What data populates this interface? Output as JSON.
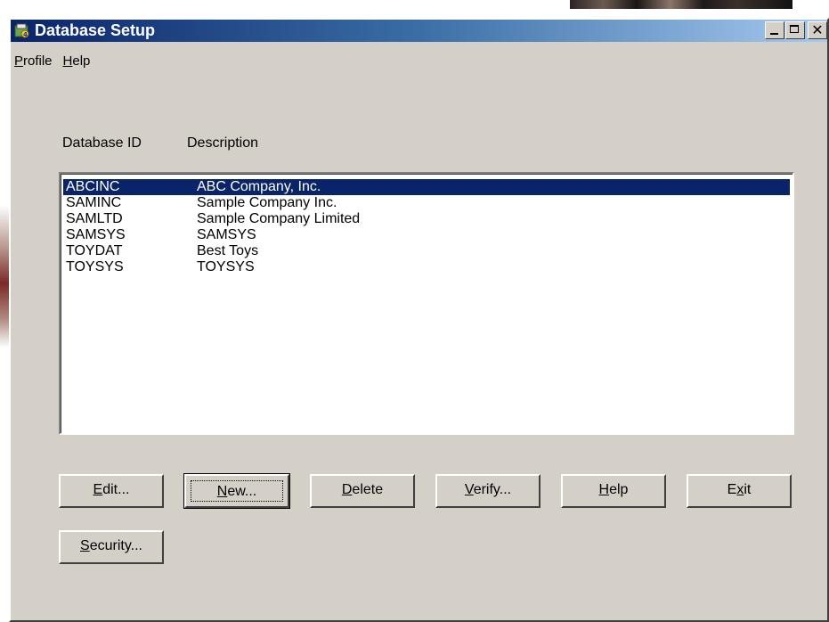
{
  "window": {
    "title": "Database Setup",
    "icon": "database-setup-app-icon"
  },
  "title_buttons": {
    "minimize": "minimize-icon",
    "maximize": "maximize-icon",
    "close_glyph": "✕"
  },
  "menu": {
    "items": [
      {
        "label_accel": "P",
        "label_rest": "rofile"
      },
      {
        "label_accel": "H",
        "label_rest": "elp"
      }
    ]
  },
  "list": {
    "columns": [
      "Database ID",
      "Description"
    ],
    "rows": [
      {
        "id": "ABCINC",
        "description": "ABC Company, Inc.",
        "selected": true
      },
      {
        "id": "SAMINC",
        "description": "Sample Company Inc.",
        "selected": false
      },
      {
        "id": "SAMLTD",
        "description": "Sample Company Limited",
        "selected": false
      },
      {
        "id": "SAMSYS",
        "description": "SAMSYS",
        "selected": false
      },
      {
        "id": "TOYDAT",
        "description": "Best Toys",
        "selected": false
      },
      {
        "id": "TOYSYS",
        "description": "TOYSYS",
        "selected": false
      }
    ]
  },
  "buttons": {
    "edit": {
      "accel": "E",
      "rest": "dit..."
    },
    "new": {
      "accel": "N",
      "rest": "ew..."
    },
    "delete": {
      "accel": "D",
      "rest": "elete"
    },
    "verify": {
      "accel": "V",
      "rest": "erify..."
    },
    "help": {
      "accel": "H",
      "rest": "elp"
    },
    "exit": {
      "pre": "E",
      "accel": "x",
      "rest": "it"
    },
    "security": {
      "accel": "S",
      "rest": "ecurity..."
    }
  },
  "colors": {
    "face": "#d4d0c8",
    "title_start": "#0a246a",
    "title_end": "#a6caf0",
    "selection": "#0a246a"
  }
}
